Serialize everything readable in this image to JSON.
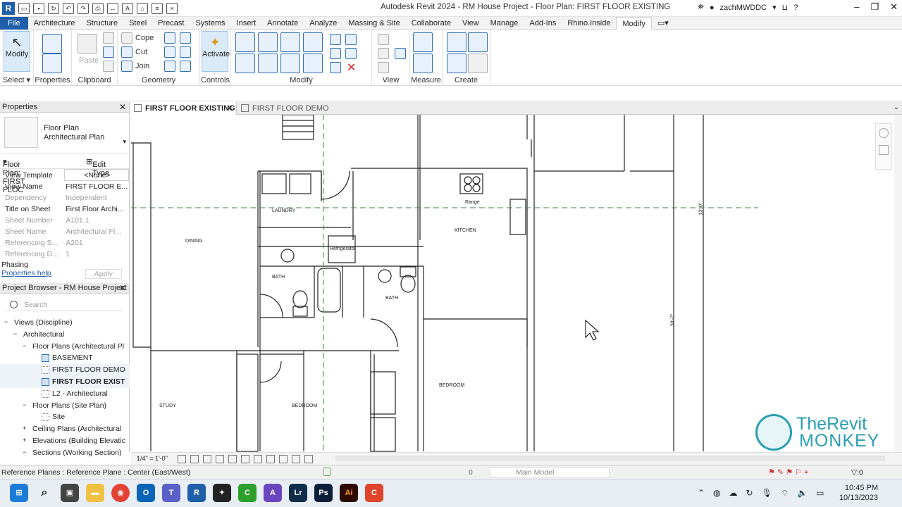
{
  "window": {
    "title": "Autodesk Revit 2024 - RM House Project - Floor Plan: FIRST FLOOR EXISTING",
    "user": "zachMWDDC"
  },
  "ribbon": {
    "tabs": [
      "File",
      "Architecture",
      "Structure",
      "Steel",
      "Precast",
      "Systems",
      "Insert",
      "Annotate",
      "Analyze",
      "Massing & Site",
      "Collaborate",
      "View",
      "Manage",
      "Add-Ins",
      "Rhino.Inside",
      "Modify"
    ],
    "active_tab": "Modify",
    "panels": {
      "select": "Select",
      "properties": "Properties",
      "clipboard": "Clipboard",
      "geometry": "Geometry",
      "controls": "Controls",
      "modify": "Modify",
      "view": "View",
      "measure": "Measure",
      "create": "Create"
    },
    "buttons": {
      "modify": "Modify",
      "paste": "Paste",
      "cope": "Cope",
      "cut": "Cut",
      "join": "Join",
      "activate": "Activate"
    }
  },
  "properties": {
    "title": "Properties",
    "type_name_1": "Floor Plan",
    "type_name_2": "Architectural Plan",
    "instance_selector": "Floor Plan: FIRST FLOC",
    "edit_type": "Edit Type",
    "rows": [
      {
        "label": "View Template",
        "value": "<None>"
      },
      {
        "label": "View Name",
        "value": "FIRST FLOOR E..."
      },
      {
        "label": "Dependency",
        "value": "Independent"
      },
      {
        "label": "Title on Sheet",
        "value": "First Floor Archi..."
      },
      {
        "label": "Sheet Number",
        "value": "A101.1"
      },
      {
        "label": "Sheet Name",
        "value": "Architectural Fl..."
      },
      {
        "label": "Referencing S...",
        "value": "A201"
      },
      {
        "label": "Referencing D...",
        "value": "1"
      }
    ],
    "phasing": "Phasing",
    "help_link": "Properties help",
    "apply": "Apply"
  },
  "browser": {
    "title": "Project Browser - RM House Project",
    "search_placeholder": "Search",
    "items": [
      {
        "label": "Views (Discipline)",
        "indent": 0,
        "toggle": "−"
      },
      {
        "label": "Architectural",
        "indent": 1,
        "toggle": "−"
      },
      {
        "label": "Floor Plans (Architectural Pl",
        "indent": 2,
        "toggle": "−"
      },
      {
        "label": "BASEMENT",
        "indent": 3,
        "icon": "view"
      },
      {
        "label": "FIRST FLOOR DEMO",
        "indent": 3,
        "icon": "view-gray"
      },
      {
        "label": "FIRST FLOOR EXIST",
        "indent": 3,
        "icon": "view",
        "bold": true
      },
      {
        "label": "L2 - Architectural",
        "indent": 3,
        "icon": "view-gray"
      },
      {
        "label": "Floor Plans (Site Plan)",
        "indent": 2,
        "toggle": "−"
      },
      {
        "label": "Site",
        "indent": 3,
        "icon": "view-gray"
      },
      {
        "label": "Ceiling Plans (Architectural",
        "indent": 2,
        "toggle": "+"
      },
      {
        "label": "Elevations (Building Elevatic",
        "indent": 2,
        "toggle": "+"
      },
      {
        "label": "Sections (Working Section)",
        "indent": 2,
        "toggle": "−"
      }
    ]
  },
  "view_tabs": [
    {
      "label": "FIRST FLOOR EXISTING",
      "active": true
    },
    {
      "label": "FIRST FLOOR DEMO",
      "active": false
    }
  ],
  "plan": {
    "rooms": [
      "LAUNDRY",
      "DINING",
      "KITCHEN",
      "BATH",
      "BATH",
      "STUDY",
      "BEDROOM",
      "BEDROOM"
    ],
    "labels": [
      "Refrigerator",
      "Range"
    ],
    "dims": [
      "38'-7\"",
      "13'-0\""
    ]
  },
  "view_control": {
    "scale": "1/4\" = 1'-0\""
  },
  "status": {
    "message": "Reference Planes : Reference Plane : Center (East/West)",
    "worksets_count": "0",
    "design_option": "Main Model",
    "filter_count": "0"
  },
  "watermark": {
    "line1": "TheRevit",
    "line2": "MONKEY"
  },
  "taskbar": {
    "time": "10:45 PM",
    "date": "10/13/2023"
  }
}
